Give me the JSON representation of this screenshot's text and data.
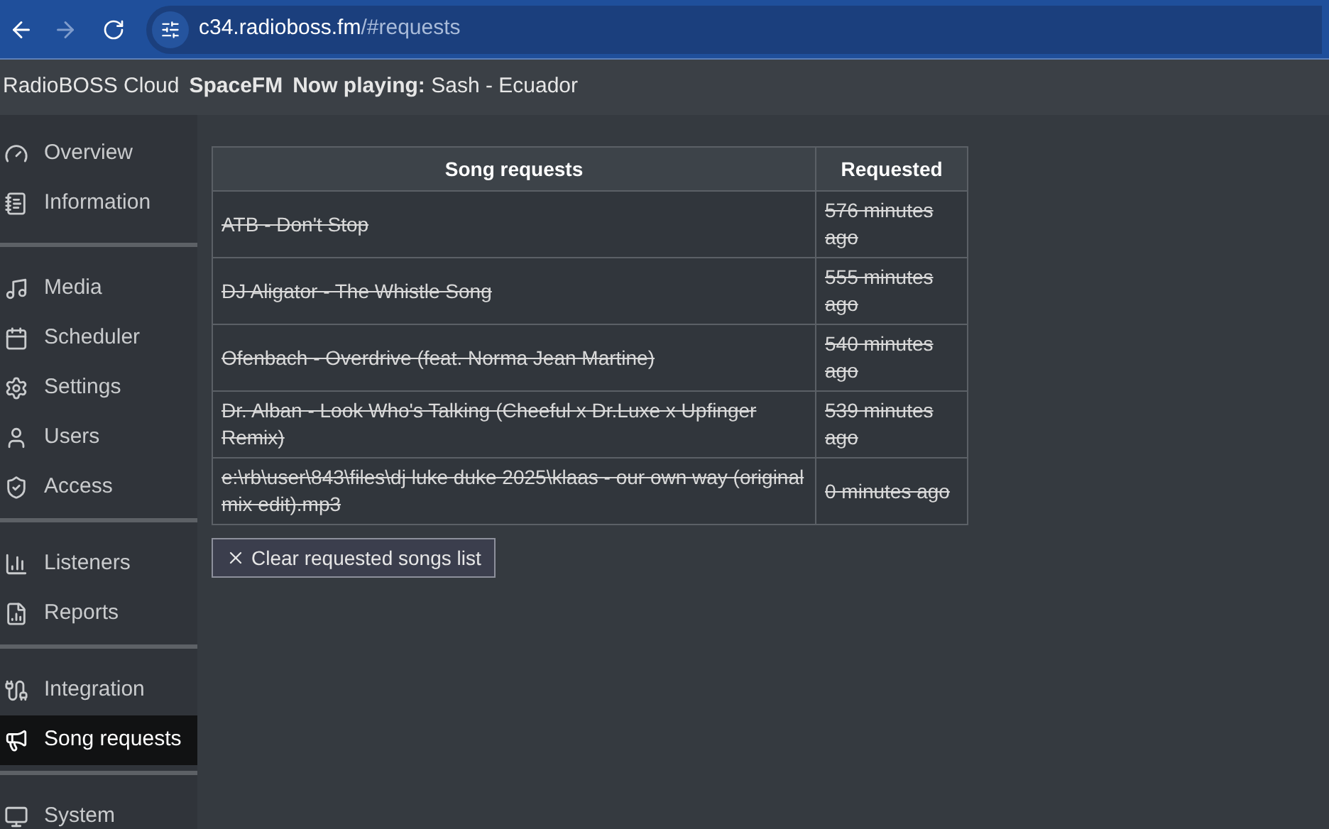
{
  "browser": {
    "back_enabled": true,
    "forward_enabled": false,
    "url_host": "c34.radioboss.fm",
    "url_path": "/#requests"
  },
  "header": {
    "app_name": "RadioBOSS Cloud",
    "station": "SpaceFM",
    "now_playing_label": "Now playing:",
    "now_playing": "Sash - Ecuador"
  },
  "sidebar": {
    "groups": [
      [
        {
          "label": "Overview",
          "selected": false
        },
        {
          "label": "Information",
          "selected": false
        }
      ],
      [
        {
          "label": "Media",
          "selected": false
        },
        {
          "label": "Scheduler",
          "selected": false
        },
        {
          "label": "Settings",
          "selected": false
        },
        {
          "label": "Users",
          "selected": false
        },
        {
          "label": "Access",
          "selected": false
        }
      ],
      [
        {
          "label": "Listeners",
          "selected": false
        },
        {
          "label": "Reports",
          "selected": false
        }
      ],
      [
        {
          "label": "Integration",
          "selected": false
        },
        {
          "label": "Song requests",
          "selected": true
        }
      ],
      [
        {
          "label": "System",
          "selected": false
        }
      ]
    ]
  },
  "table": {
    "columns": [
      "Song requests",
      "Requested"
    ],
    "rows": [
      {
        "song": "ATB - Don't Stop",
        "requested": "576 minutes ago",
        "played": true
      },
      {
        "song": "DJ Aligator - The Whistle Song",
        "requested": "555 minutes ago",
        "played": true
      },
      {
        "song": "Ofenbach - Overdrive (feat. Norma Jean Martine)",
        "requested": "540 minutes ago",
        "played": true
      },
      {
        "song": "Dr. Alban - Look Who's Talking (Cheeful x Dr.Luxe x Upfinger Remix)",
        "requested": "539 minutes ago",
        "played": true
      },
      {
        "song": "e:\\rb\\user\\843\\files\\dj luke duke 2025\\klaas - our own way (original mix edit).mp3",
        "requested": "0 minutes ago",
        "played": true
      }
    ]
  },
  "clear_button": {
    "label": "Clear requested songs list"
  }
}
